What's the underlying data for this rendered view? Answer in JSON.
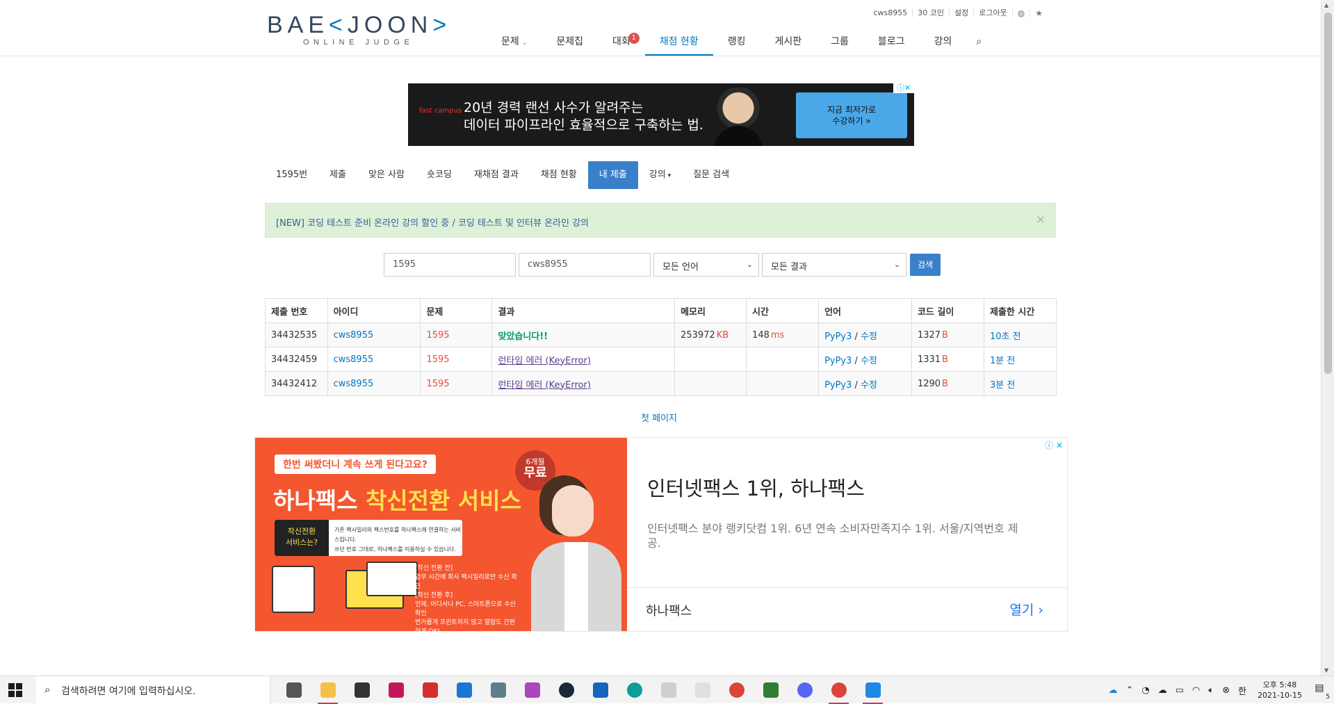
{
  "logo": {
    "main_a": "BAE",
    "main_b": "JOON",
    "sub": "ONLINE JUDGE"
  },
  "util": {
    "user": "cws8955",
    "coins": "30 코인",
    "settings": "설정",
    "logout": "로그아웃",
    "globe_icon": "globe-icon",
    "star_icon": "star-icon"
  },
  "nav": {
    "items": [
      {
        "label": "문제",
        "caret": true
      },
      {
        "label": "문제집"
      },
      {
        "label": "대회",
        "badge": "1"
      },
      {
        "label": "채점 현황",
        "active": true
      },
      {
        "label": "랭킹"
      },
      {
        "label": "게시판"
      },
      {
        "label": "그룹"
      },
      {
        "label": "블로그"
      },
      {
        "label": "강의"
      }
    ],
    "search_icon": "search-icon"
  },
  "ad_top": {
    "brand": "fast campus",
    "line1": "20년 경력 랜선 사수가 알려주는",
    "line2": "데이터 파이프라인 효율적으로 구축하는 법.",
    "cta": "지금 최저가로\n수강하기 »"
  },
  "subtabs": [
    "1595번",
    "제출",
    "맞은 사람",
    "숏코딩",
    "재채점 결과",
    "채점 현황",
    "내 제출",
    "강의",
    "질문 검색"
  ],
  "alert": {
    "text": "[NEW] 코딩 테스트 준비 온라인 강의 할인 중 / 코딩 테스트 및 인터뷰 온라인 강의"
  },
  "filter": {
    "problem": "1595",
    "user": "cws8955",
    "language": "모든 언어",
    "result": "모든 결과",
    "search": "검색"
  },
  "table": {
    "headers": [
      "제출 번호",
      "아이디",
      "문제",
      "결과",
      "메모리",
      "시간",
      "언어",
      "코드 길이",
      "제출한 시간"
    ],
    "rows": [
      {
        "id": "34432535",
        "user": "cws8955",
        "problem": "1595",
        "result": "맞았습니다!!",
        "result_type": "ok",
        "memory": "253972",
        "memory_unit": "KB",
        "time": "148",
        "time_unit": "ms",
        "lang": "PyPy3",
        "edit": "수정",
        "length": "1327",
        "length_unit": "B",
        "submitted": "10초 전"
      },
      {
        "id": "34432459",
        "user": "cws8955",
        "problem": "1595",
        "result": "런타임 에러 (KeyError)",
        "result_type": "err",
        "memory": "",
        "memory_unit": "",
        "time": "",
        "time_unit": "",
        "lang": "PyPy3",
        "edit": "수정",
        "length": "1331",
        "length_unit": "B",
        "submitted": "1분 전"
      },
      {
        "id": "34432412",
        "user": "cws8955",
        "problem": "1595",
        "result": "런타임 에러 (KeyError)",
        "result_type": "err",
        "memory": "",
        "memory_unit": "",
        "time": "",
        "time_unit": "",
        "lang": "PyPy3",
        "edit": "수정",
        "length": "1290",
        "length_unit": "B",
        "submitted": "3분 전"
      }
    ]
  },
  "first_page": "첫 페이지",
  "ad_bottom": {
    "pill": "한번 써봤더니 계속 쓰게 된다고요?",
    "headline_a": "하나팩스 ",
    "headline_b": "착신전환 서비스",
    "circle_a": "6개월",
    "circle_b": "무료",
    "box_label": "착신전환\n서비스는?",
    "box_text": "기존 팩시밀리의 팩스번호를 하나팩스에 연결하는 서비스입니다.\n쓰던 번호 그대로, 하나팩스를 이용하실 수 있습니다.",
    "small": "[착신 전환 전]\n업무 시간에 회사 팩시밀리로만 수신 확인\n[착신 전환 후]\n언제, 어디서나 PC, 스마트폰으로 수신 확인\n번거롭게 프린트하지 않고 열람도 간편하게 OK!\n팩스 분실, 보안 걱정 없이 아주 관리하기 가능",
    "title": "인터넷팩스 1위, 하나팩스",
    "desc": "인터넷팩스 분야 랭키닷컴 1위. 6년 연속 소비자만족지수 1위. 서울/지역번호 제공.",
    "advertiser": "하나팩스",
    "open": "열기"
  },
  "taskbar": {
    "search_placeholder": "검색하려면 여기에 입력하십시오.",
    "apps": [
      {
        "name": "task-view-icon",
        "color": "#555555"
      },
      {
        "name": "file-explorer-icon",
        "color": "#f5c04a",
        "open": true
      },
      {
        "name": "store-icon",
        "color": "#333333"
      },
      {
        "name": "app-magenta-icon",
        "color": "#c2185b"
      },
      {
        "name": "app-sync-icon",
        "color": "#d32f2f"
      },
      {
        "name": "mail-icon",
        "color": "#1976d2"
      },
      {
        "name": "settings-app-icon",
        "color": "#607d8b"
      },
      {
        "name": "app-diamond-icon",
        "color": "#ab47bc"
      },
      {
        "name": "steam-icon",
        "color": "#1b2838"
      },
      {
        "name": "reader-icon",
        "color": "#1565c0"
      },
      {
        "name": "edge-icon",
        "color": "#0f9d9a"
      },
      {
        "name": "document-icon",
        "color": "#cfcfcf"
      },
      {
        "name": "typora-icon",
        "color": "#e0e0e0"
      },
      {
        "name": "chrome-icon",
        "color": "#db4437"
      },
      {
        "name": "app-green-icon",
        "color": "#2e7d32"
      },
      {
        "name": "discord-icon",
        "color": "#5865f2"
      },
      {
        "name": "chrome-active-icon",
        "color": "#db4437",
        "open": true
      },
      {
        "name": "vscode-icon",
        "color": "#1e88e5",
        "open": true
      }
    ],
    "ime": "한",
    "time": "오후 5:48",
    "date": "2021-10-15",
    "notifications": "5"
  }
}
